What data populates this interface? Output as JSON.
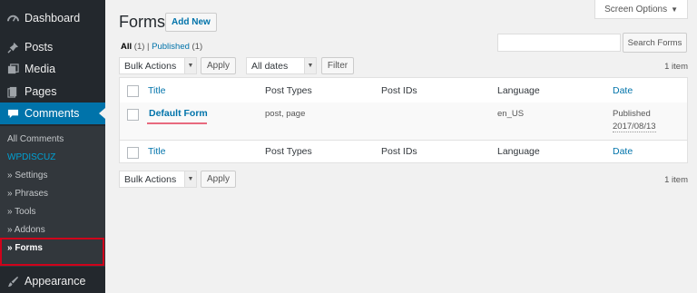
{
  "sidebar": {
    "items": [
      {
        "label": "Dashboard",
        "icon": "dashboard-icon"
      },
      {
        "label": "Posts",
        "icon": "pin-icon"
      },
      {
        "label": "Media",
        "icon": "media-icon"
      },
      {
        "label": "Pages",
        "icon": "pages-icon"
      },
      {
        "label": "Comments",
        "icon": "comment-icon"
      },
      {
        "label": "Appearance",
        "icon": "paintbrush-icon"
      }
    ],
    "submenu": [
      "All Comments",
      "WPDISCUZ",
      "» Settings",
      "» Phrases",
      "» Tools",
      "» Addons",
      "» Forms"
    ]
  },
  "header": {
    "title": "Forms",
    "add_new": "Add New",
    "screen_options": "Screen Options",
    "screen_options_arrow": "▼"
  },
  "filters": {
    "all_label": "All",
    "all_count": "(1)",
    "separator": "|",
    "published_label": "Published",
    "published_count": "(1)",
    "search_button": "Search Forms",
    "bulk_actions": "Bulk Actions",
    "apply": "Apply",
    "dates": "All dates",
    "filter": "Filter",
    "items_count": "1 item"
  },
  "table": {
    "columns": [
      "Title",
      "Post Types",
      "Post IDs",
      "Language",
      "Date"
    ],
    "rows": [
      {
        "title": "Default Form",
        "post_types": "post, page",
        "post_ids": "",
        "language": "en_US",
        "date_status": "Published",
        "date_value": "2017/08/13"
      }
    ]
  },
  "bottom": {
    "bulk_actions": "Bulk Actions",
    "apply": "Apply",
    "items_count": "1 item"
  },
  "colors": {
    "sidebar_bg": "#23282d",
    "submenu_bg": "#32373c",
    "accent": "#0073aa",
    "highlight": "#d0021b"
  }
}
